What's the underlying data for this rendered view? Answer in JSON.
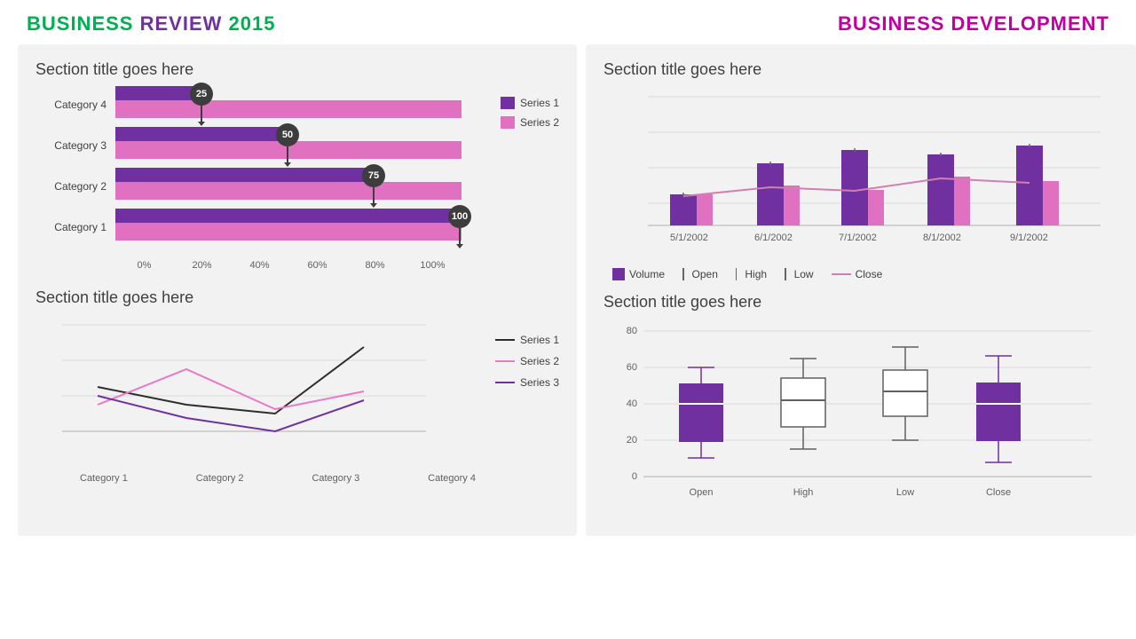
{
  "header": {
    "left": {
      "business": "BUSINESS",
      "review": " REVIEW ",
      "year": "2015"
    },
    "right": "BUSINESS DEVELOPMENT"
  },
  "top_left_section": {
    "title": "Section title goes here",
    "legend": {
      "series1_label": "Series 1",
      "series2_label": "Series 2"
    },
    "categories": [
      "Category 4",
      "Category 3",
      "Category 2",
      "Category 1"
    ],
    "bars": [
      {
        "s1_pct": 25,
        "s2_pct": 100,
        "label": "25"
      },
      {
        "s1_pct": 50,
        "s2_pct": 100,
        "label": "50"
      },
      {
        "s1_pct": 75,
        "s2_pct": 100,
        "label": "75"
      },
      {
        "s1_pct": 100,
        "s2_pct": 100,
        "label": "100"
      }
    ],
    "x_ticks": [
      "0%",
      "20%",
      "40%",
      "60%",
      "80%",
      "100%"
    ]
  },
  "bottom_left_section": {
    "title": "Section title goes here",
    "x_labels": [
      "Category 1",
      "Category 2",
      "Category 3",
      "Category 4"
    ],
    "legend": {
      "series1": "Series 1",
      "series2": "Series 2",
      "series3": "Series 3"
    }
  },
  "top_right_section": {
    "title": "Section title goes here",
    "x_labels": [
      "5/1/2002",
      "6/1/2002",
      "7/1/2002",
      "8/1/2002",
      "9/1/2002"
    ],
    "legend": {
      "volume": "Volume",
      "open": "Open",
      "high": "High",
      "low": "Low",
      "close": "Close"
    }
  },
  "bottom_right_section": {
    "title": "Section title goes here",
    "y_ticks": [
      "80",
      "60",
      "40",
      "20",
      "0"
    ],
    "x_labels": [
      "Open",
      "High",
      "Low",
      "Close"
    ]
  }
}
